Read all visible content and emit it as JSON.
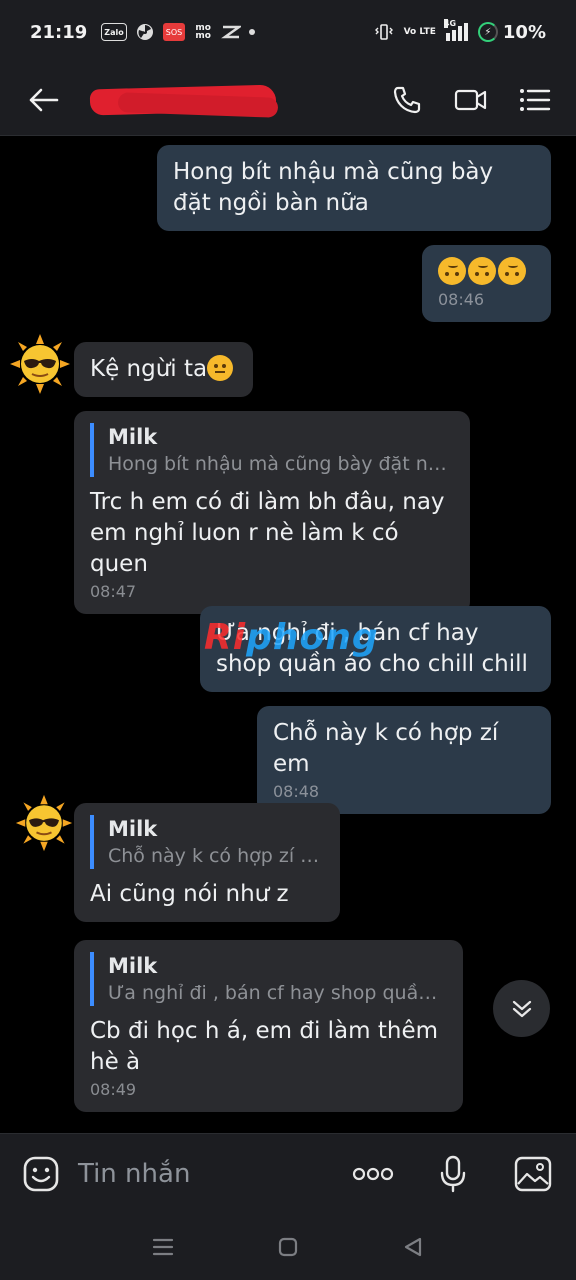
{
  "status_bar": {
    "time": "21:19",
    "notification_icons": [
      "zalo",
      "radiation-icon",
      "SOS",
      "momo",
      "capcut-icon"
    ],
    "network": "4G",
    "volte": "Vo LTE",
    "battery": "10%"
  },
  "header": {
    "contact_name": "[redacted]",
    "back_icon": "arrow-left-icon",
    "call_icon": "phone-icon",
    "video_icon": "video-camera-icon",
    "menu_icon": "list-menu-icon"
  },
  "messages": [
    {
      "direction": "out",
      "text": "Hong bít nhậu mà cũng bày đặt ngồi bàn nữa"
    },
    {
      "direction": "out",
      "text": "🙃🙃🙃",
      "time": "08:46"
    },
    {
      "direction": "in",
      "text": "Kệ ngừi ta",
      "emoji": "unamused-face"
    },
    {
      "direction": "in",
      "quote_name": "Milk",
      "quote_text": "Hong bít nhậu mà cũng bày đặt ngồ...",
      "text": "Trc h em có đi làm bh đâu, nay em nghỉ luon r nè làm k có quen",
      "time": "08:47"
    },
    {
      "direction": "out",
      "text": "Ưa nghỉ đi , bán cf hay shop quần áo cho chill chill"
    },
    {
      "direction": "out",
      "text": "Chỗ này k có hợp zí em",
      "time": "08:48"
    },
    {
      "direction": "in",
      "quote_name": "Milk",
      "quote_text": "Chỗ này k có hợp zí em",
      "text": "Ai cũng nói như z"
    },
    {
      "direction": "in",
      "quote_name": "Milk",
      "quote_text": "Ưa nghỉ đi , bán cf hay shop quần á...",
      "text": "Cb đi học h á, em đi làm thêm hè à",
      "time": "08:49"
    }
  ],
  "watermark": {
    "part1": "Ri",
    "part2": "phong"
  },
  "input": {
    "placeholder": "Tin nhắn"
  },
  "colors": {
    "outgoing_bubble": "#2c3a49",
    "incoming_bubble": "#2a2b2f",
    "quote_bar": "#3c8dff",
    "background": "#000000"
  }
}
